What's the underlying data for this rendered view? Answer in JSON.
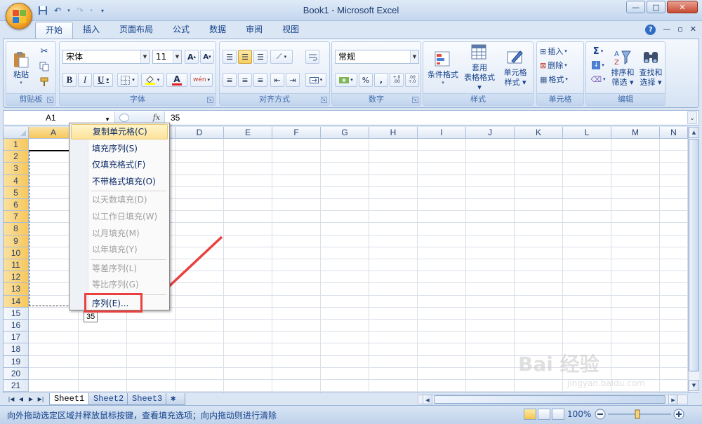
{
  "window": {
    "title": "Book1 - Microsoft Excel",
    "controls": {
      "minimize": "—",
      "restore": "□",
      "close": "✕"
    }
  },
  "ribbon_tabs": [
    "开始",
    "插入",
    "页面布局",
    "公式",
    "数据",
    "审阅",
    "视图"
  ],
  "clipboard": {
    "paste_label": "粘贴",
    "group_label": "剪贴板"
  },
  "font": {
    "name": "宋体",
    "size": "11",
    "bold": "B",
    "italic": "I",
    "underline": "U",
    "font_color_letter": "A",
    "wen": "wén",
    "grow": "A",
    "shrink": "A",
    "group_label": "字体"
  },
  "alignment": {
    "group_label": "对齐方式"
  },
  "number": {
    "format": "常规",
    "percent": "%",
    "comma": ",",
    "inc": "+.0\n.00",
    "dec": ".00\n+.0",
    "group_label": "数字"
  },
  "styles": {
    "conditional": "条件格式",
    "table_line1": "套用",
    "table_line2": "表格格式",
    "cell_line1": "单元格",
    "cell_line2": "样式",
    "group_label": "样式"
  },
  "cells": {
    "insert": "插入",
    "delete": "删除",
    "format": "格式",
    "group_label": "单元格"
  },
  "editing": {
    "sigma": "Σ",
    "sort_line1": "排序和",
    "sort_line2": "筛选",
    "find_line1": "查找和",
    "find_line2": "选择",
    "group_label": "编辑"
  },
  "formula_bar": {
    "name_box": "A1",
    "fx": "fx",
    "value": "35"
  },
  "columns": [
    "A",
    "B",
    "C",
    "D",
    "E",
    "F",
    "G",
    "H",
    "I",
    "J",
    "K",
    "L",
    "M",
    "N"
  ],
  "rows": [
    "1",
    "2",
    "3",
    "4",
    "5",
    "6",
    "7",
    "8",
    "9",
    "10",
    "11",
    "12",
    "13",
    "14",
    "15",
    "16",
    "17",
    "18",
    "19",
    "20",
    "21"
  ],
  "cell_a1": "35",
  "fill_tooltip": "35",
  "context_menu": [
    {
      "label": "复制单元格(C)",
      "enabled": true,
      "highlighted": true
    },
    {
      "label": "填充序列(S)",
      "enabled": true
    },
    {
      "label": "仅填充格式(F)",
      "enabled": true
    },
    {
      "label": "不带格式填充(O)",
      "enabled": true
    },
    {
      "label": "以天数填充(D)",
      "enabled": false
    },
    {
      "label": "以工作日填充(W)",
      "enabled": false
    },
    {
      "label": "以月填充(M)",
      "enabled": false
    },
    {
      "label": "以年填充(Y)",
      "enabled": false
    },
    {
      "label": "等差序列(L)",
      "enabled": false
    },
    {
      "label": "等比序列(G)",
      "enabled": false
    },
    {
      "label": "序列(E)...",
      "enabled": true
    }
  ],
  "sheets": [
    "Sheet1",
    "Sheet2",
    "Sheet3"
  ],
  "status": {
    "text": "向外拖动选定区域并释放鼠标按键，查看填充选项；向内拖动则进行清除",
    "zoom": "100%"
  },
  "watermark": {
    "brand": "Bai 经验",
    "url": "jingyan.baidu.com"
  },
  "colors": {
    "accent": "#15428b",
    "annotation_red": "#e8413e"
  }
}
